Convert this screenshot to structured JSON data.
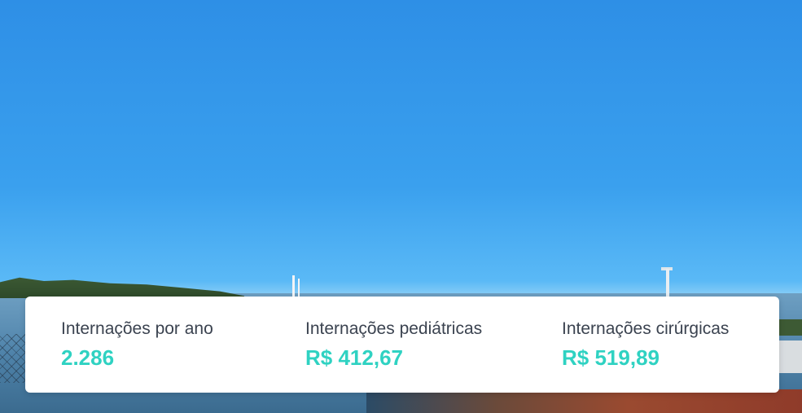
{
  "stats": [
    {
      "label": "Internações por ano",
      "value": "2.286"
    },
    {
      "label": "Internações pediátricas",
      "value": "R$ 412,67"
    },
    {
      "label": "Internações cirúrgicas",
      "value": "R$ 519,89"
    }
  ],
  "colors": {
    "accent": "#2fd2c2",
    "label_text": "#3b4350",
    "card_background": "#ffffff",
    "sky": "#3aa0ee"
  }
}
